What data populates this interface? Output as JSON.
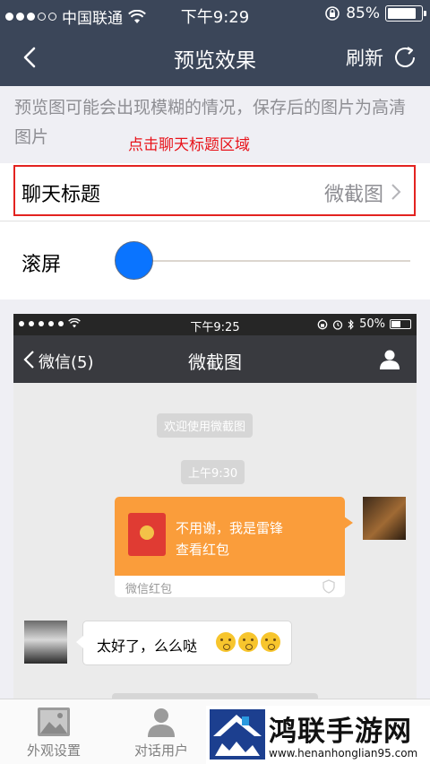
{
  "status_bar": {
    "carrier": "中国联通",
    "time": "下午9:29",
    "battery": "85%",
    "battery_level": 0.85
  },
  "nav": {
    "title": "预览效果",
    "refresh_label": "刷新"
  },
  "hint": {
    "text": "预览图可能会出现模糊的情况，保存后的图片为高清图片",
    "annotation": "点击聊天标题区域"
  },
  "settings": {
    "chat_title_label": "聊天标题",
    "chat_title_value": "微截图",
    "scroll_label": "滚屏",
    "scroll_value": 0
  },
  "preview": {
    "status_time": "下午9:25",
    "status_battery": "50%",
    "back_label": "微信(5)",
    "title": "微截图",
    "system_msg": "欢迎使用微截图",
    "timestamp": "上午9:30",
    "red_packet": {
      "line1": "不用谢，我是雷锋",
      "line2": "查看红包",
      "footer": "微信红包"
    },
    "incoming_text": "太好了，么么哒"
  },
  "tabs": [
    {
      "label": "外观设置",
      "icon": "image-icon"
    },
    {
      "label": "对话用户",
      "icon": "user-icon"
    }
  ],
  "watermark": {
    "name": "鸿联手游网",
    "url": "www.henanhonglian95.com"
  },
  "colors": {
    "nav_bg": "#3b4659",
    "annotation_red": "#e8141b",
    "slider_knob": "#0a74ff",
    "red_packet": "#fa9d3b"
  }
}
